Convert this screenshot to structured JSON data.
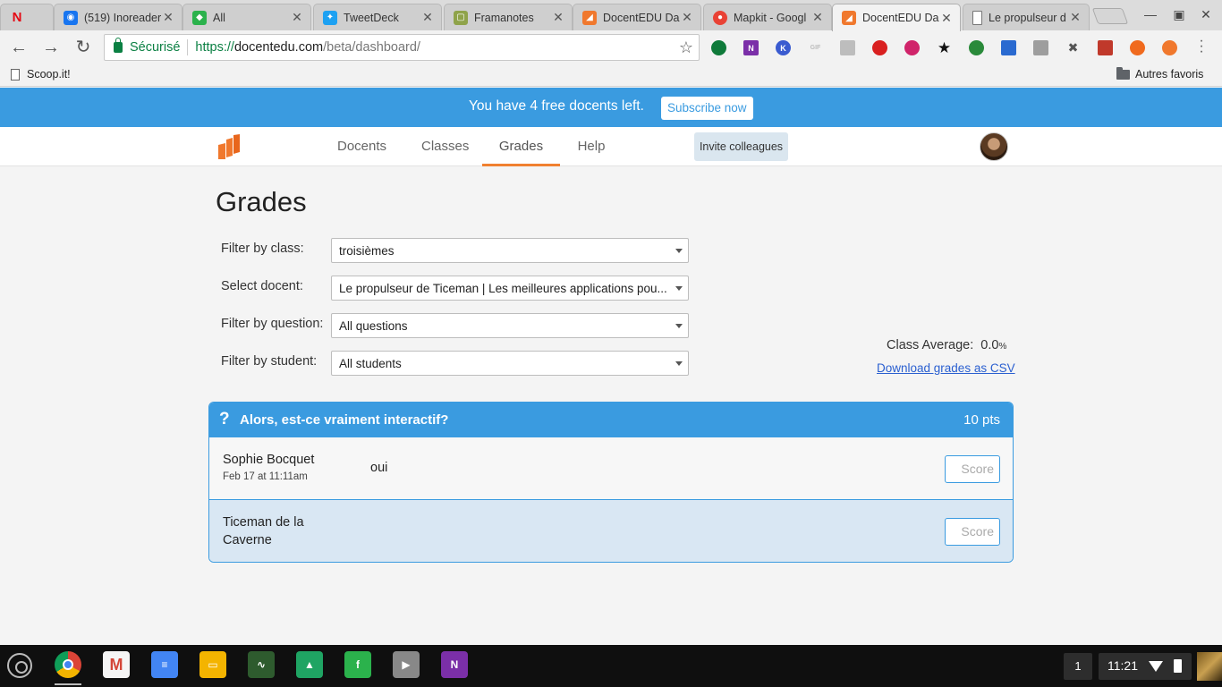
{
  "browser": {
    "tabs": [
      {
        "title": "",
        "favicon": "netflix-icon",
        "color": "#e50914",
        "glyph": "N"
      },
      {
        "title": "(519) Inoreader",
        "favicon": "inoreader-icon",
        "color": "#1875f0",
        "glyph": "◉"
      },
      {
        "title": "All",
        "favicon": "feedly-icon",
        "color": "#2bb24c",
        "glyph": "◆"
      },
      {
        "title": "TweetDeck",
        "favicon": "twitter-icon",
        "color": "#1da1f2",
        "glyph": "✦"
      },
      {
        "title": "Framanotes",
        "favicon": "framanotes-icon",
        "color": "#8fa34a",
        "glyph": "▢"
      },
      {
        "title": "DocentEDU Da",
        "favicon": "docentedu-icon",
        "color": "#f0782d",
        "glyph": "◢"
      },
      {
        "title": "Mapkit - Googl",
        "favicon": "mapkit-icon",
        "color": "#e94235",
        "glyph": "●"
      },
      {
        "title": "DocentEDU Da",
        "favicon": "docentedu-icon",
        "color": "#f0782d",
        "glyph": "◢"
      },
      {
        "title": "Le propulseur d",
        "favicon": "page-icon",
        "color": "#ffffff",
        "glyph": ""
      }
    ],
    "url_secure_label": "Sécurisé",
    "url_scheme": "https://",
    "url_host": "docentedu.com",
    "url_path": "/beta/dashboard/",
    "bookmarks": {
      "left": "Scoop.it!",
      "right": "Autres favoris"
    },
    "extensions": [
      {
        "name": "ext-green-icon",
        "color": "#0f7a3a"
      },
      {
        "name": "onenote-ext-icon",
        "color": "#7b2fa8",
        "glyph": "N"
      },
      {
        "name": "k-ext-icon",
        "color": "#3a5bd0",
        "glyph": "K"
      },
      {
        "name": "gif-ext-icon",
        "color": "#bdbdbd",
        "glyph": "GIF"
      },
      {
        "name": "rss-ext-icon",
        "color": "#bdbdbd"
      },
      {
        "name": "red-ext-icon",
        "color": "#d92020"
      },
      {
        "name": "pink-ext-icon",
        "color": "#d0246a"
      },
      {
        "name": "star-ext-icon",
        "color": "#111111",
        "glyph": "★"
      },
      {
        "name": "turtle-ext-icon",
        "color": "#2a8a3a"
      },
      {
        "name": "cast-ext-icon",
        "color": "#2a6ad0"
      },
      {
        "name": "gray-ext-icon",
        "color": "#9e9e9e"
      },
      {
        "name": "tools-ext-icon",
        "color": "#555555",
        "glyph": "✖"
      },
      {
        "name": "book-ext-icon",
        "color": "#c0392b"
      },
      {
        "name": "orange-ext-icon",
        "color": "#f06a1e"
      },
      {
        "name": "docentedu-ext-icon",
        "color": "#f0782d"
      }
    ]
  },
  "banner": {
    "message": "You have 4 free docents left.",
    "subscribe_label": "Subscribe now"
  },
  "nav": {
    "items": [
      "Docents",
      "Classes",
      "Grades",
      "Help"
    ],
    "active": "Grades",
    "invite_label": "Invite colleagues"
  },
  "page": {
    "title": "Grades",
    "filters": [
      {
        "label": "Filter by class:",
        "value": "troisièmes"
      },
      {
        "label": "Select docent:",
        "value": "Le propulseur de Ticeman | Les meilleures applications pou..."
      },
      {
        "label": "Filter by question:",
        "value": "All questions"
      },
      {
        "label": "Filter by student:",
        "value": "All students"
      }
    ],
    "class_average_label": "Class Average:",
    "class_average_value": "0.0",
    "class_average_unit": "%",
    "download_label": "Download grades as CSV"
  },
  "question": {
    "icon": "?",
    "title": "Alors, est-ce vraiment interactif?",
    "points": "10 pts",
    "answers": [
      {
        "student": "Sophie Bocquet",
        "date": "Feb 17 at 11:11am",
        "answer": "oui",
        "score_placeholder": "Score"
      },
      {
        "student": "Ticeman de la Caverne",
        "date": "",
        "answer": "",
        "score_placeholder": "Score"
      }
    ]
  },
  "shelf": {
    "apps": [
      {
        "name": "chrome-icon",
        "color": "#4285f4"
      },
      {
        "name": "gmail-icon",
        "color": "#d44638",
        "glyph": "M"
      },
      {
        "name": "docs-icon",
        "color": "#4285f4",
        "glyph": "≡"
      },
      {
        "name": "slides-icon",
        "color": "#f4b400",
        "glyph": "▭"
      },
      {
        "name": "stream-icon",
        "color": "#2e5b2e",
        "glyph": "∿"
      },
      {
        "name": "drive-icon",
        "color": "#1fa463",
        "glyph": "▲"
      },
      {
        "name": "feedly-icon",
        "color": "#2bb24c",
        "glyph": "f"
      },
      {
        "name": "play-store-icon",
        "color": "#888888",
        "glyph": "▶"
      },
      {
        "name": "onenote-icon",
        "color": "#7b2fa8",
        "glyph": "N"
      }
    ],
    "notification_count": "1",
    "clock": "11:21"
  }
}
